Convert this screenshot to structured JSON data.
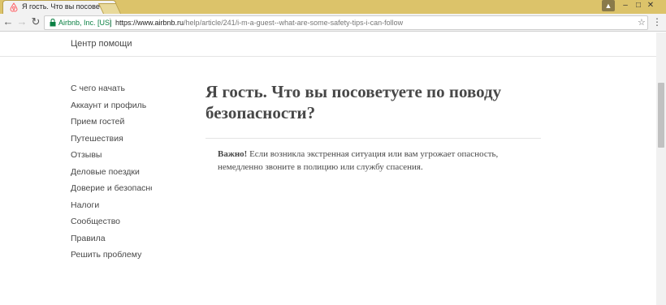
{
  "browser": {
    "tab_title": "Я гость. Что вы посовет",
    "tab_close": "×",
    "secure_label": "Airbnb, Inc. [US]",
    "url_host": "https://www.airbnb.ru",
    "url_path": "/help/article/241/i-m-a-guest--what-are-some-safety-tips-i-can-follow",
    "buttons": {
      "back": "←",
      "forward": "→",
      "reload": "↻",
      "star": "☆",
      "menu": "⋮",
      "minimize": "–",
      "maximize": "□",
      "close": "✕",
      "user": "▲"
    }
  },
  "header": {
    "title": "Центр помощи"
  },
  "sidebar": {
    "items": [
      {
        "label": "С чего начать"
      },
      {
        "label": "Аккаунт и профиль"
      },
      {
        "label": "Прием гостей"
      },
      {
        "label": "Путешествия"
      },
      {
        "label": "Отзывы"
      },
      {
        "label": "Деловые поездки"
      },
      {
        "label": "Доверие и безопасность"
      },
      {
        "label": "Налоги"
      },
      {
        "label": "Сообщество"
      },
      {
        "label": "Правила"
      },
      {
        "label": "Решить проблему"
      }
    ]
  },
  "article": {
    "title": "Я гость. Что вы посоветуете по поводу безопасности?",
    "notice_strong": "Важно!",
    "notice_text": "Если возникла экстренная ситуация или вам угрожает опасность, немедленно звоните в полицию или службу спасения."
  },
  "colors": {
    "titlebar": "#dcc36a",
    "text": "#484848",
    "secure_green": "#0b8043",
    "airbnb_brand": "#ff5a5f"
  }
}
